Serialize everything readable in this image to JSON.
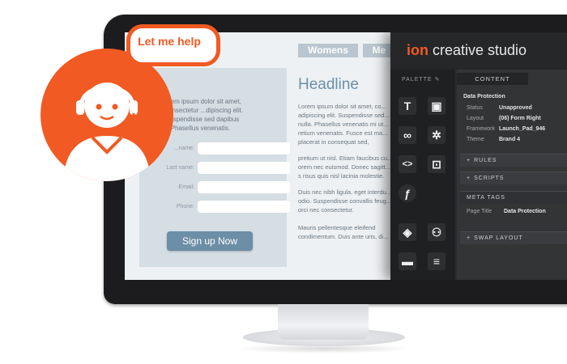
{
  "helper": {
    "bubble_text": "Let me help",
    "icon": "support-agent-icon",
    "accent": "#f15a22"
  },
  "landing": {
    "tabs": [
      "Womens",
      "Me"
    ],
    "headline": "Headline",
    "form_intro": "...em ipsum dolor sit amet, consectetur ...dipiscing elit. Suspendisse sed dapibus ...Phasellus venenatis.",
    "form_fields": [
      {
        "label": "...name:"
      },
      {
        "label": "Last name:"
      },
      {
        "label": "Email:"
      },
      {
        "label": "Phone:"
      }
    ],
    "signup_label": "Sign up Now",
    "paragraphs": [
      "Lorem ipsum dolor sit amet, co... adipiscing elit. Suspendisse sed... nulla. Phasellus venenatis mi ut... retium venenatis. Fusce est ma... placerat in consequat sed,",
      "pretium ut nisl. Etiam faucibus cu... orem nec euismod. Donec sagitt... s risus quis nisl lacinia molestie.",
      "Duis nec nibh ligula, eget interdu... odio. Suspendisse convallis feug... orci nec consectetur.",
      "Mauris pellentesque eleifend condimentum. Duis ante uris, di..."
    ]
  },
  "studio": {
    "brand_prefix": "ion",
    "brand_suffix": " creative studio",
    "palette_title": "PALETTE",
    "palette_icons": [
      {
        "name": "text-icon",
        "glyph": "T"
      },
      {
        "name": "image-icon",
        "glyph": "▣"
      },
      {
        "name": "link-icon",
        "glyph": "∞"
      },
      {
        "name": "widget-icon",
        "glyph": "✲"
      },
      {
        "name": "code-icon",
        "glyph": "<>"
      },
      {
        "name": "frame-icon",
        "glyph": "⊡"
      },
      {
        "name": "flash-icon",
        "glyph": "ƒ"
      },
      {
        "name": "layers-icon",
        "glyph": "◈"
      },
      {
        "name": "sitemap-icon",
        "glyph": "⚇"
      },
      {
        "name": "video-icon",
        "glyph": "▬"
      },
      {
        "name": "list-icon",
        "glyph": "≡"
      }
    ],
    "content_tab": "CONTENT",
    "section_title": "Data Protection",
    "properties": [
      {
        "key": "Status",
        "value": "Unapproved"
      },
      {
        "key": "Layout",
        "value": "(06) Form Right"
      },
      {
        "key": "Framework",
        "value": "Launch_Pad_946"
      },
      {
        "key": "Theme",
        "value": "Brand 4"
      }
    ],
    "rules_label": "RULES",
    "scripts_label": "SCRIPTS",
    "meta_label": "META TAGS",
    "page_title_key": "Page Title",
    "page_title_value": "Data Protection",
    "swap_label": "SWAP LAYOUT",
    "accent": "#f15a22"
  }
}
